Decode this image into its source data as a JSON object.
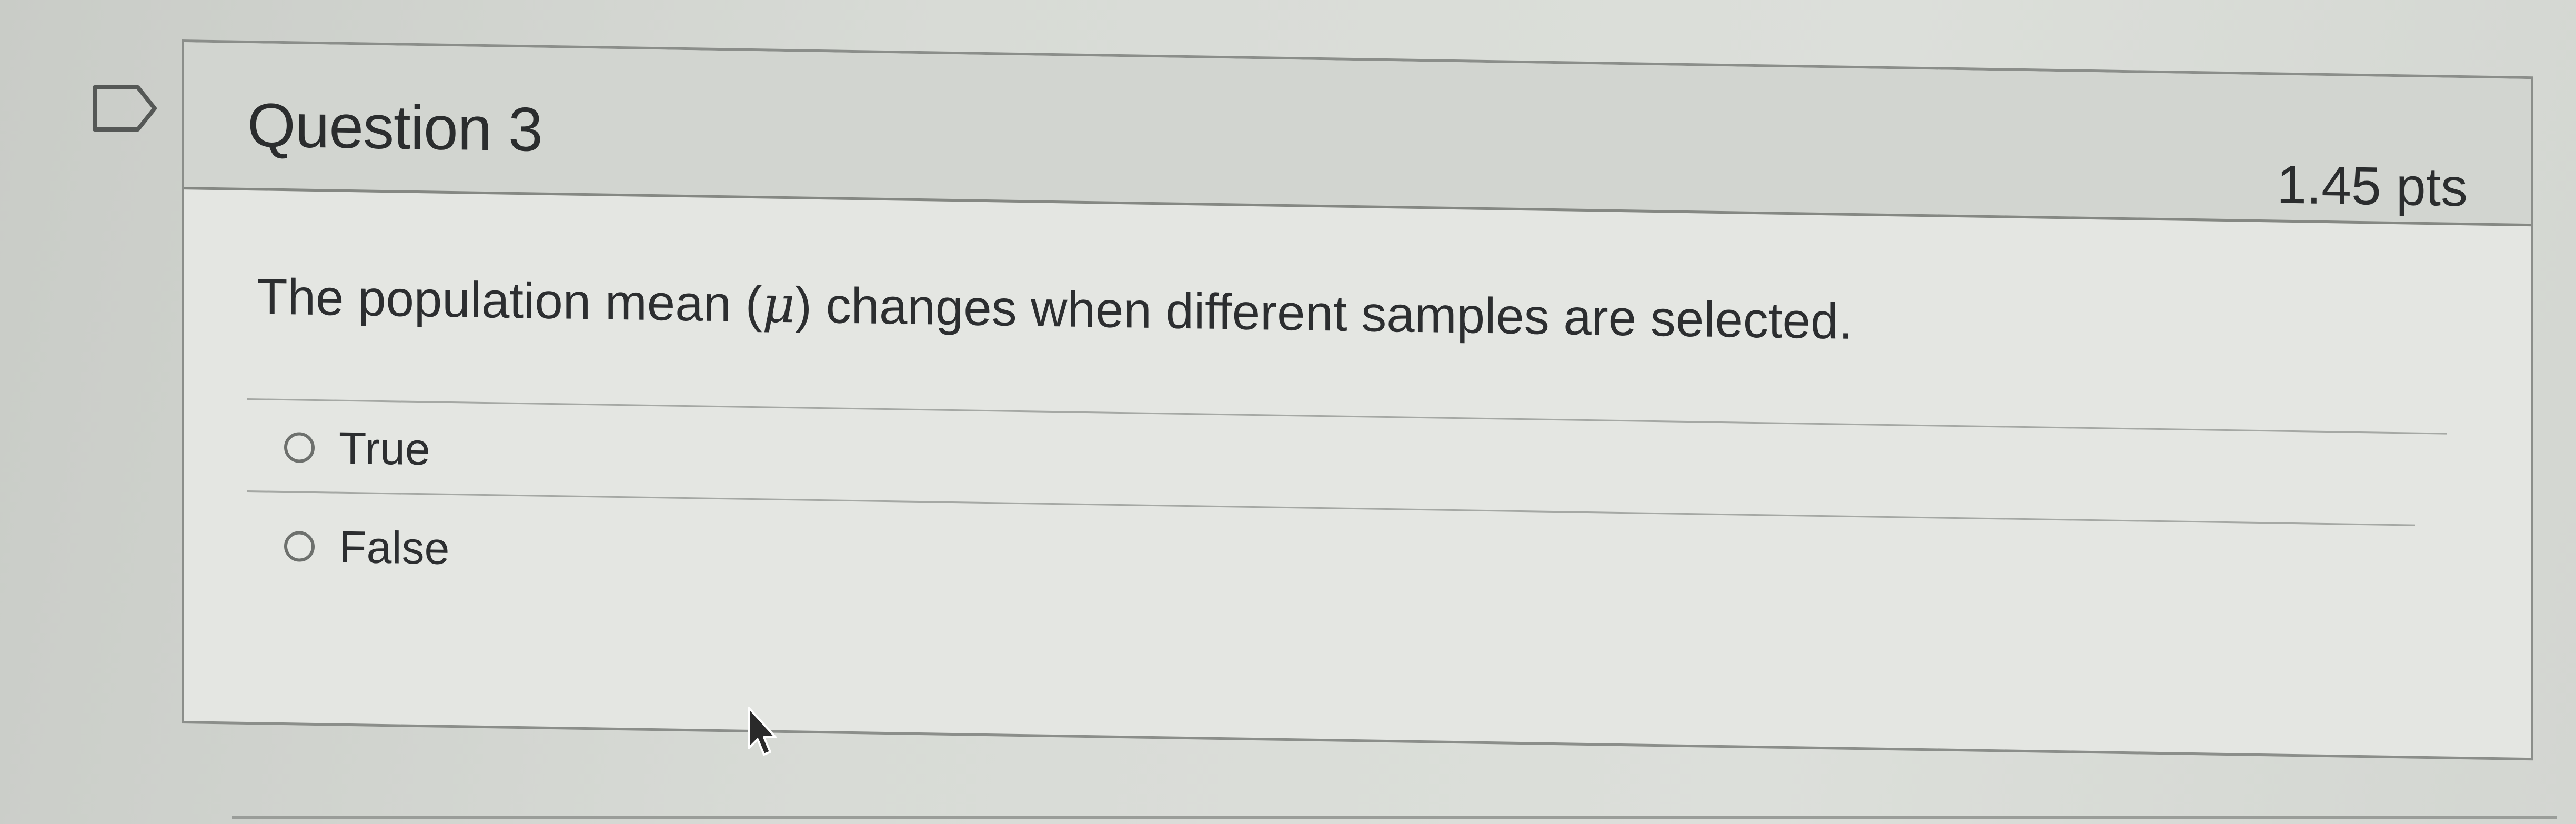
{
  "question": {
    "title": "Question 3",
    "points": "1.45 pts",
    "text_before": "The population mean (",
    "symbol": "μ",
    "text_after": ") changes when different samples are selected."
  },
  "answers": [
    {
      "label": "True",
      "selected": false
    },
    {
      "label": "False",
      "selected": false
    }
  ],
  "icons": {
    "flag": "flag-icon",
    "radio": "radio-icon",
    "cursor": "mouse-pointer-icon"
  },
  "colors": {
    "background": "#d8dbd6",
    "header": "#d2d5d0",
    "border": "#8b8e8a",
    "text": "#2b2d2e"
  }
}
